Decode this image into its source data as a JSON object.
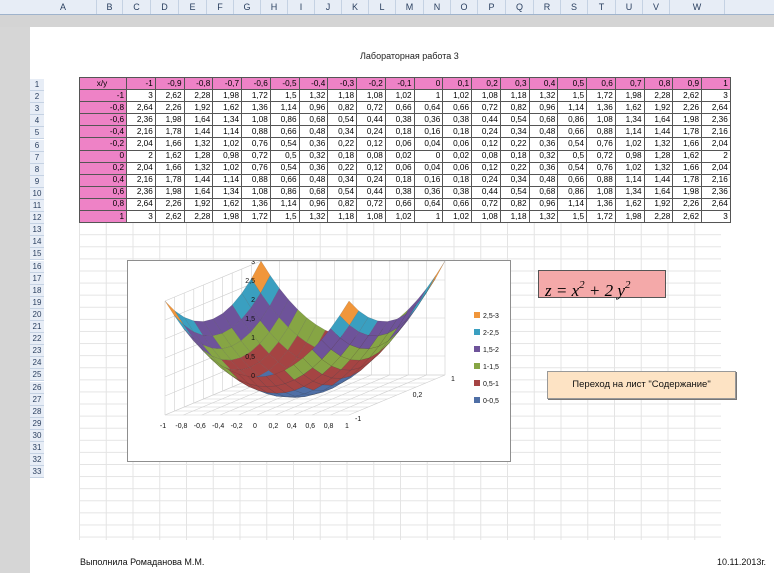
{
  "columns": [
    "A",
    "B",
    "C",
    "D",
    "E",
    "F",
    "G",
    "H",
    "I",
    "J",
    "K",
    "L",
    "M",
    "N",
    "O",
    "P",
    "Q",
    "R",
    "S",
    "T",
    "U",
    "V",
    "W"
  ],
  "rows": [
    "1",
    "2",
    "3",
    "4",
    "5",
    "6",
    "7",
    "8",
    "9",
    "10",
    "11",
    "12",
    "13",
    "14",
    "15",
    "16",
    "17",
    "18",
    "19",
    "20",
    "21",
    "22",
    "23",
    "24",
    "25",
    "26",
    "27",
    "28",
    "29",
    "30",
    "31",
    "32",
    "33"
  ],
  "title": "Лабораторная работа 3",
  "table": {
    "corner": "x/y",
    "x_headers": [
      "-1",
      "-0,9",
      "-0,8",
      "-0,7",
      "-0,6",
      "-0,5",
      "-0,4",
      "-0,3",
      "-0,2",
      "-0,1",
      "0",
      "0,1",
      "0,2",
      "0,3",
      "0,4",
      "0,5",
      "0,6",
      "0,7",
      "0,8",
      "0,9",
      "1"
    ],
    "rows": [
      {
        "y": "-1",
        "values": [
          "3",
          "2,62",
          "2,28",
          "1,98",
          "1,72",
          "1,5",
          "1,32",
          "1,18",
          "1,08",
          "1,02",
          "1",
          "1,02",
          "1,08",
          "1,18",
          "1,32",
          "1,5",
          "1,72",
          "1,98",
          "2,28",
          "2,62",
          "3"
        ]
      },
      {
        "y": "-0,8",
        "values": [
          "2,64",
          "2,26",
          "1,92",
          "1,62",
          "1,36",
          "1,14",
          "0,96",
          "0,82",
          "0,72",
          "0,66",
          "0,64",
          "0,66",
          "0,72",
          "0,82",
          "0,96",
          "1,14",
          "1,36",
          "1,62",
          "1,92",
          "2,26",
          "2,64"
        ]
      },
      {
        "y": "-0,6",
        "values": [
          "2,36",
          "1,98",
          "1,64",
          "1,34",
          "1,08",
          "0,86",
          "0,68",
          "0,54",
          "0,44",
          "0,38",
          "0,36",
          "0,38",
          "0,44",
          "0,54",
          "0,68",
          "0,86",
          "1,08",
          "1,34",
          "1,64",
          "1,98",
          "2,36"
        ]
      },
      {
        "y": "-0,4",
        "values": [
          "2,16",
          "1,78",
          "1,44",
          "1,14",
          "0,88",
          "0,66",
          "0,48",
          "0,34",
          "0,24",
          "0,18",
          "0,16",
          "0,18",
          "0,24",
          "0,34",
          "0,48",
          "0,66",
          "0,88",
          "1,14",
          "1,44",
          "1,78",
          "2,16"
        ]
      },
      {
        "y": "-0,2",
        "values": [
          "2,04",
          "1,66",
          "1,32",
          "1,02",
          "0,76",
          "0,54",
          "0,36",
          "0,22",
          "0,12",
          "0,06",
          "0,04",
          "0,06",
          "0,12",
          "0,22",
          "0,36",
          "0,54",
          "0,76",
          "1,02",
          "1,32",
          "1,66",
          "2,04"
        ]
      },
      {
        "y": "0",
        "values": [
          "2",
          "1,62",
          "1,28",
          "0,98",
          "0,72",
          "0,5",
          "0,32",
          "0,18",
          "0,08",
          "0,02",
          "0",
          "0,02",
          "0,08",
          "0,18",
          "0,32",
          "0,5",
          "0,72",
          "0,98",
          "1,28",
          "1,62",
          "2"
        ]
      },
      {
        "y": "0,2",
        "values": [
          "2,04",
          "1,66",
          "1,32",
          "1,02",
          "0,76",
          "0,54",
          "0,36",
          "0,22",
          "0,12",
          "0,06",
          "0,04",
          "0,06",
          "0,12",
          "0,22",
          "0,36",
          "0,54",
          "0,76",
          "1,02",
          "1,32",
          "1,66",
          "2,04"
        ]
      },
      {
        "y": "0,4",
        "values": [
          "2,16",
          "1,78",
          "1,44",
          "1,14",
          "0,88",
          "0,66",
          "0,48",
          "0,34",
          "0,24",
          "0,18",
          "0,16",
          "0,18",
          "0,24",
          "0,34",
          "0,48",
          "0,66",
          "0,88",
          "1,14",
          "1,44",
          "1,78",
          "2,16"
        ]
      },
      {
        "y": "0,6",
        "values": [
          "2,36",
          "1,98",
          "1,64",
          "1,34",
          "1,08",
          "0,86",
          "0,68",
          "0,54",
          "0,44",
          "0,38",
          "0,36",
          "0,38",
          "0,44",
          "0,54",
          "0,68",
          "0,86",
          "1,08",
          "1,34",
          "1,64",
          "1,98",
          "2,36"
        ]
      },
      {
        "y": "0,8",
        "values": [
          "2,64",
          "2,26",
          "1,92",
          "1,62",
          "1,36",
          "1,14",
          "0,96",
          "0,82",
          "0,72",
          "0,66",
          "0,64",
          "0,66",
          "0,72",
          "0,82",
          "0,96",
          "1,14",
          "1,36",
          "1,62",
          "1,92",
          "2,26",
          "2,64"
        ]
      },
      {
        "y": "1",
        "values": [
          "3",
          "2,62",
          "2,28",
          "1,98",
          "1,72",
          "1,5",
          "1,32",
          "1,18",
          "1,08",
          "1,02",
          "1",
          "1,02",
          "1,08",
          "1,18",
          "1,32",
          "1,5",
          "1,72",
          "1,98",
          "2,28",
          "2,62",
          "3"
        ]
      }
    ]
  },
  "chart": {
    "z_ticks": [
      "0",
      "0,5",
      "1",
      "1,5",
      "2",
      "2,5",
      "3"
    ],
    "x_ticks": [
      "-1",
      "-0,8",
      "-0,6",
      "-0,4",
      "-0,2",
      "0",
      "0,2",
      "0,4",
      "0,6",
      "0,8",
      "1"
    ],
    "y_ticks": [
      "1",
      "0,2",
      "-1"
    ],
    "bands": [
      {
        "label": "0-0,5",
        "color": "#4f6fa6",
        "lo": 0,
        "hi": 0.5
      },
      {
        "label": "0,5-1",
        "color": "#a54443",
        "lo": 0.5,
        "hi": 1
      },
      {
        "label": "1-1,5",
        "color": "#86a544",
        "lo": 1,
        "hi": 1.5
      },
      {
        "label": "1,5-2",
        "color": "#6e539a",
        "lo": 1.5,
        "hi": 2
      },
      {
        "label": "2-2,5",
        "color": "#3a9fc0",
        "lo": 2,
        "hi": 2.5
      },
      {
        "label": "2,5-3",
        "color": "#f0963b",
        "lo": 2.5,
        "hi": 3
      }
    ]
  },
  "formula": {
    "z": "z",
    "eq": "=",
    "x": "x",
    "p1": "2",
    "plus": "+",
    "coef": "2",
    "y": "y",
    "p2": "2"
  },
  "nav_button": "Переход на лист \"Содержание\"",
  "author": "Выполнила Ромаданова М.М.",
  "date": "10.11.2013г."
}
